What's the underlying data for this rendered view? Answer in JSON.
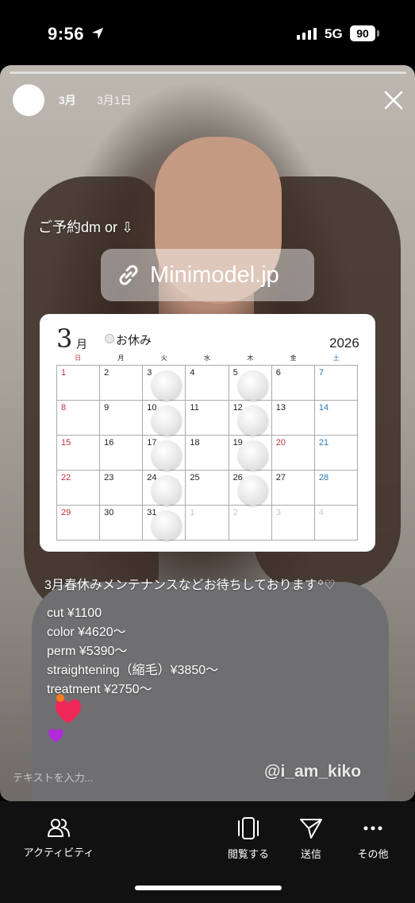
{
  "status_bar": {
    "time": "9:56",
    "network": "5G",
    "battery": "90"
  },
  "story": {
    "header": {
      "name": "3月",
      "date": "3月1日"
    },
    "reserve_text": "ご予約dm or ⇩",
    "link_sticker": {
      "url": "Minimodel.jp"
    },
    "calendar": {
      "month": "3",
      "month_suffix": "月",
      "holiday_label": "お休み",
      "year": "2026",
      "weekdays": [
        "日",
        "月",
        "火",
        "水",
        "木",
        "金",
        "土"
      ],
      "days": [
        [
          "1",
          "2",
          "3",
          "4",
          "5",
          "6",
          "7"
        ],
        [
          "8",
          "9",
          "10",
          "11",
          "12",
          "13",
          "14"
        ],
        [
          "15",
          "16",
          "17",
          "18",
          "19",
          "20",
          "21"
        ],
        [
          "22",
          "23",
          "24",
          "25",
          "26",
          "27",
          "28"
        ],
        [
          "29",
          "30",
          "31",
          "1",
          "2",
          "3",
          "4"
        ]
      ]
    },
    "message": "3月春休みメンテナンスなどお待ちしております꙳♡",
    "prices": [
      "cut ¥1100",
      "color ¥4620〜",
      "perm ¥5390〜",
      "straightening（縮毛）¥3850〜",
      "treatment ¥2750〜"
    ],
    "reply_placeholder": "テキストを入力...",
    "handle": "@i_am_kiko",
    "colors": {
      "sunday": "#c0323c",
      "saturday": "#2a7ab8"
    }
  },
  "bottom_bar": {
    "activity": "アクティビティ",
    "view": "閲覧する",
    "send": "送信",
    "more": "その他"
  }
}
